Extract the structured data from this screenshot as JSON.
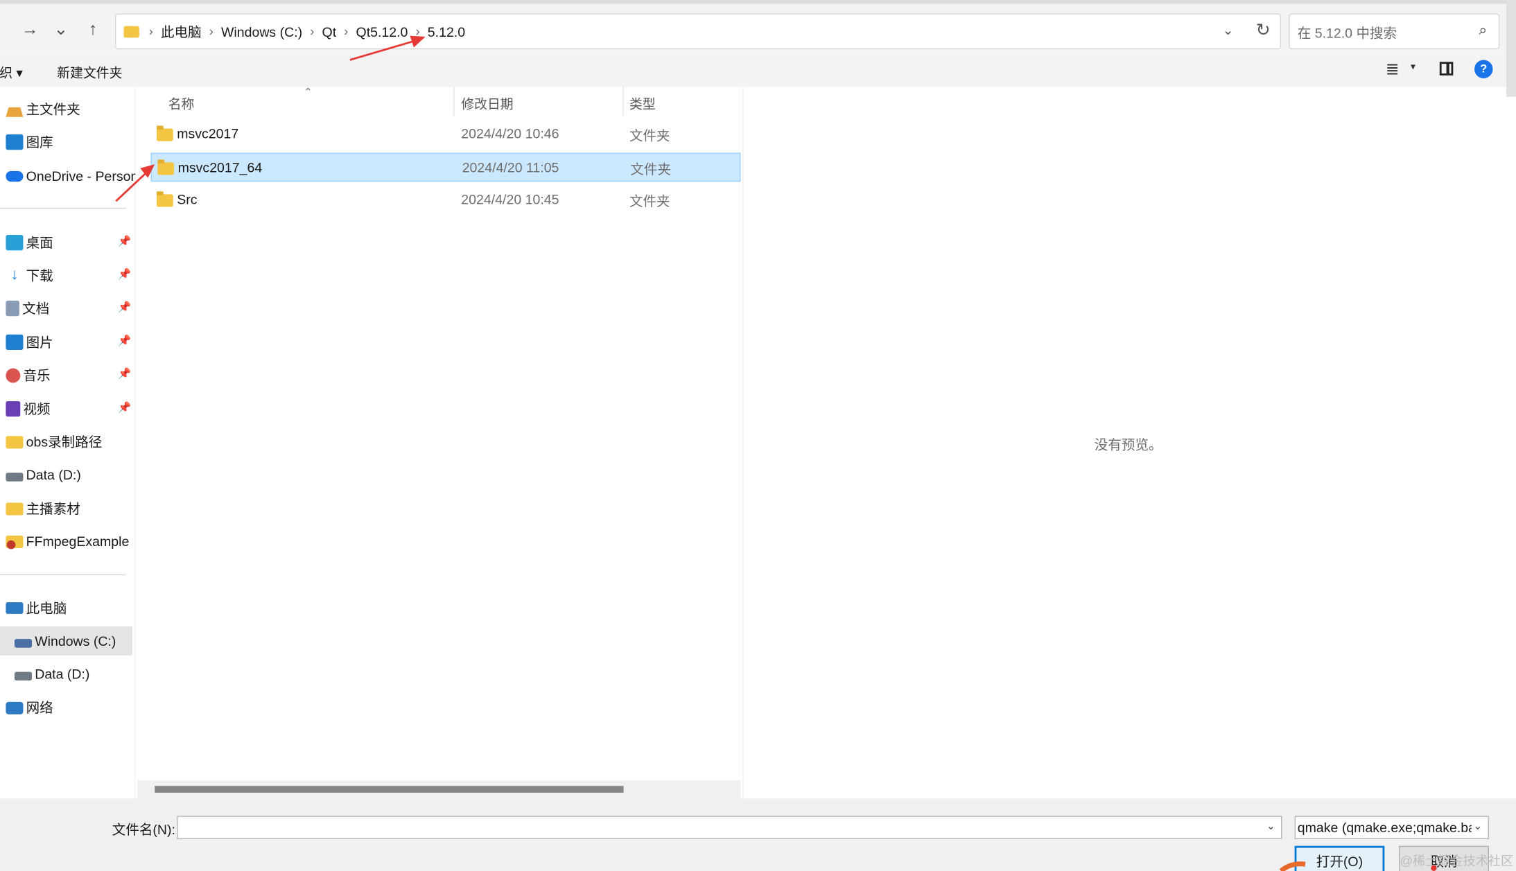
{
  "nav": {
    "back_glyph": "→",
    "recent_glyph": "⌄",
    "up_glyph": "↑"
  },
  "address": {
    "crumbs": [
      "此电脑",
      "Windows (C:)",
      "Qt",
      "Qt5.12.0",
      "5.12.0"
    ]
  },
  "search": {
    "placeholder": "在 5.12.0 中搜索"
  },
  "toolbar": {
    "organize": "组织 ▾",
    "new_folder": "新建文件夹"
  },
  "sidebar": {
    "quick": [
      {
        "label": "主文件夹",
        "icon": "home-icon"
      },
      {
        "label": "图库",
        "icon": "gallery-icon"
      },
      {
        "label": "OneDrive - Personal",
        "icon": "onedrive-icon"
      }
    ],
    "pinned": [
      {
        "label": "桌面",
        "icon": "desktop-icon"
      },
      {
        "label": "下载",
        "icon": "download-icon"
      },
      {
        "label": "文档",
        "icon": "documents-icon"
      },
      {
        "label": "图片",
        "icon": "pictures-icon"
      },
      {
        "label": "音乐",
        "icon": "music-icon"
      },
      {
        "label": "视频",
        "icon": "videos-icon"
      },
      {
        "label": "obs录制路径",
        "icon": "folder-icon"
      },
      {
        "label": "Data (D:)",
        "icon": "drive-icon"
      },
      {
        "label": "主播素材",
        "icon": "folder-icon"
      },
      {
        "label": "FFmpegExample",
        "icon": "folder-icon"
      }
    ],
    "devices": [
      {
        "label": "此电脑",
        "icon": "this-pc-icon"
      },
      {
        "label": "Windows (C:)",
        "icon": "drive-icon",
        "selected": true
      },
      {
        "label": "Data (D:)",
        "icon": "drive-icon"
      },
      {
        "label": "网络",
        "icon": "network-icon"
      }
    ]
  },
  "columns": {
    "name": "名称",
    "modified": "修改日期",
    "type": "类型"
  },
  "files": [
    {
      "name": "msvc2017",
      "modified": "2024/4/20 10:46",
      "type": "文件夹"
    },
    {
      "name": "msvc2017_64",
      "modified": "2024/4/20 11:05",
      "type": "文件夹",
      "selected": true
    },
    {
      "name": "Src",
      "modified": "2024/4/20 10:45",
      "type": "文件夹"
    }
  ],
  "preview": {
    "message": "没有预览。"
  },
  "footer": {
    "filename_label": "文件名(N):",
    "filename_value": "",
    "filetype": "qmake (qmake.exe;qmake.ba",
    "open": "打开(O)",
    "cancel": "取消"
  },
  "watermark": "@稀土掘金技术社区",
  "colors": {
    "accent": "#0078d4",
    "selection": "#cce8ff",
    "annotation": "#e53935"
  }
}
